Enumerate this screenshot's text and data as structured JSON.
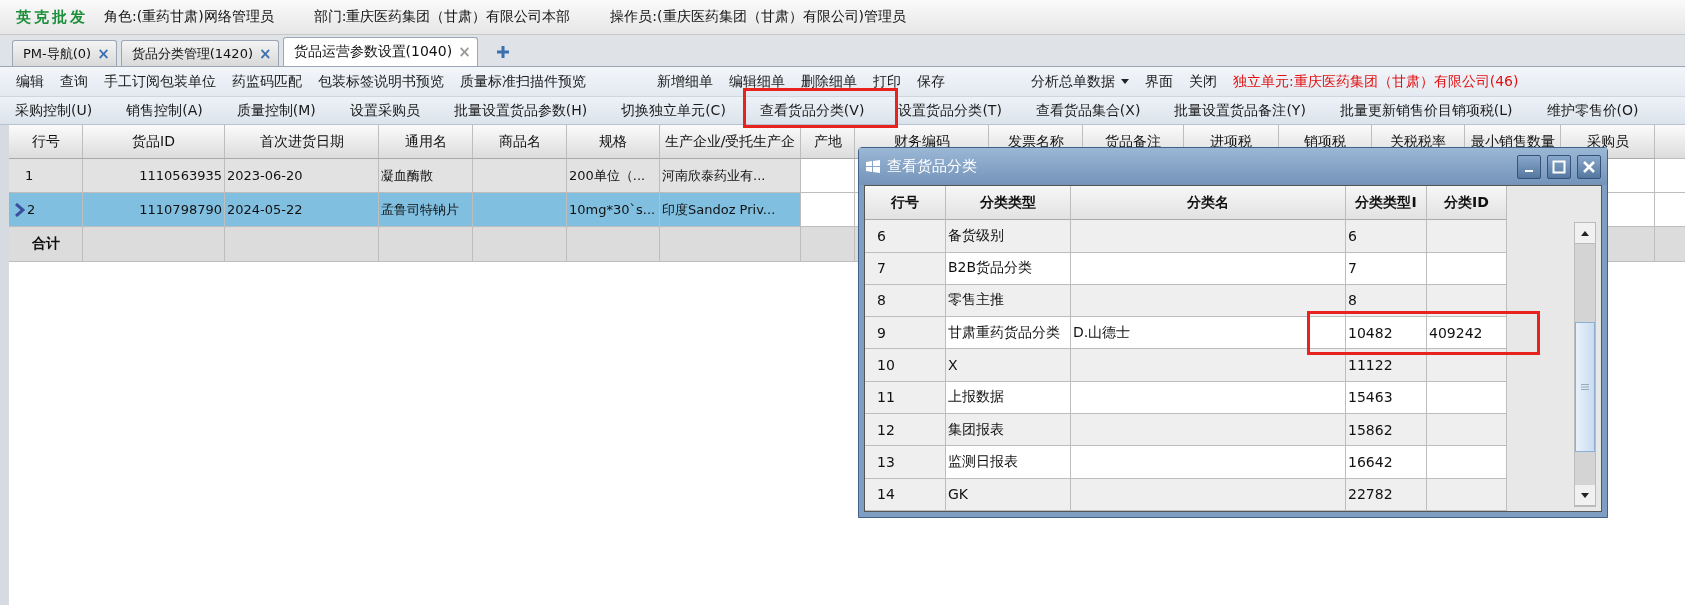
{
  "title_bar": {
    "app_name": "英克批发",
    "fields": [
      "角色:(重药甘肃)网络管理员",
      "部门:重庆医药集团（甘肃）有限公司本部",
      "操作员:(重庆医药集团（甘肃）有限公司)管理员"
    ]
  },
  "tabs": [
    {
      "label": "PM-导航(0)",
      "close": "×",
      "selected": false
    },
    {
      "label": "货品分类管理(1420)",
      "close": "×",
      "selected": false
    },
    {
      "label": "货品运营参数设置(1040)",
      "close": "×",
      "selected": true
    }
  ],
  "toolbar": {
    "groups": [
      [
        {
          "kind": "button",
          "label": "编辑"
        },
        {
          "kind": "button",
          "label": "查询"
        },
        {
          "kind": "button",
          "label": "手工订阅包装单位"
        },
        {
          "kind": "button",
          "label": "药监码匹配"
        },
        {
          "kind": "button",
          "label": "包装标签说明书预览"
        },
        {
          "kind": "button",
          "label": "质量标准扫描件预览"
        }
      ],
      [
        {
          "kind": "button",
          "label": "新增细单"
        },
        {
          "kind": "button",
          "label": "编辑细单"
        },
        {
          "kind": "button",
          "label": "删除细单"
        },
        {
          "kind": "button",
          "label": "打印"
        },
        {
          "kind": "button",
          "label": "保存"
        }
      ],
      [
        {
          "kind": "dropdown",
          "label": "分析总单数据"
        },
        {
          "kind": "button",
          "label": "界面"
        },
        {
          "kind": "button",
          "label": "关闭"
        },
        {
          "kind": "notice",
          "label": "独立单元:重庆医药集团（甘肃）有限公司(46)"
        }
      ]
    ]
  },
  "actions": [
    "采购控制(U)",
    "销售控制(A)",
    "质量控制(M)",
    "设置采购员",
    "批量设置货品参数(H)",
    "切换独立单元(C)",
    "查看货品分类(V)",
    "设置货品分类(T)",
    "查看货品集合(X)",
    "批量设置货品备注(Y)",
    "批量更新销售价目销项税(L)",
    "维护零售价(O)"
  ],
  "table": {
    "columns": [
      "行号",
      "货品ID",
      "首次进货日期",
      "通用名",
      "商品名",
      "规格",
      "生产企业/受托生产企",
      "产地",
      "财务编码",
      "发票名称",
      "货品备注",
      "进项税",
      "销项税",
      "关税税率",
      "最小销售数量",
      "采购员"
    ],
    "rows": [
      {
        "selected": false,
        "cells": [
          "1",
          "1110563935",
          "2023-06-20",
          "凝血酶散",
          null,
          "200单位（...",
          "河南欣泰药业有..."
        ]
      },
      {
        "selected": true,
        "cells": [
          "2",
          "1110798790",
          "2024-05-22",
          "孟鲁司特钠片",
          null,
          "10mg*30`s...",
          "印度Sandoz Priv..."
        ]
      }
    ],
    "total_label": "合计"
  },
  "dialog": {
    "title": "查看货品分类",
    "columns": [
      "行号",
      "分类类型",
      "分类名",
      "分类类型I",
      "分类ID"
    ],
    "rows": [
      {
        "cells": [
          "6",
          "备货级别",
          null,
          "6",
          null
        ]
      },
      {
        "cells": [
          "7",
          "B2B货品分类",
          null,
          "7",
          null
        ]
      },
      {
        "cells": [
          "8",
          "零售主推",
          null,
          "8",
          null
        ]
      },
      {
        "cells": [
          "9",
          "甘肃重药货品分类",
          "D.山德士",
          "10482",
          "409242"
        ]
      },
      {
        "cells": [
          "10",
          "X",
          null,
          "11122",
          null
        ]
      },
      {
        "cells": [
          "11",
          "上报数据",
          null,
          "15463",
          null
        ]
      },
      {
        "cells": [
          "12",
          "集团报表",
          null,
          "15862",
          null
        ]
      },
      {
        "cells": [
          "13",
          "监测日报表",
          null,
          "16642",
          null
        ]
      },
      {
        "cells": [
          "14",
          "GK",
          null,
          "22782",
          null
        ]
      }
    ]
  }
}
